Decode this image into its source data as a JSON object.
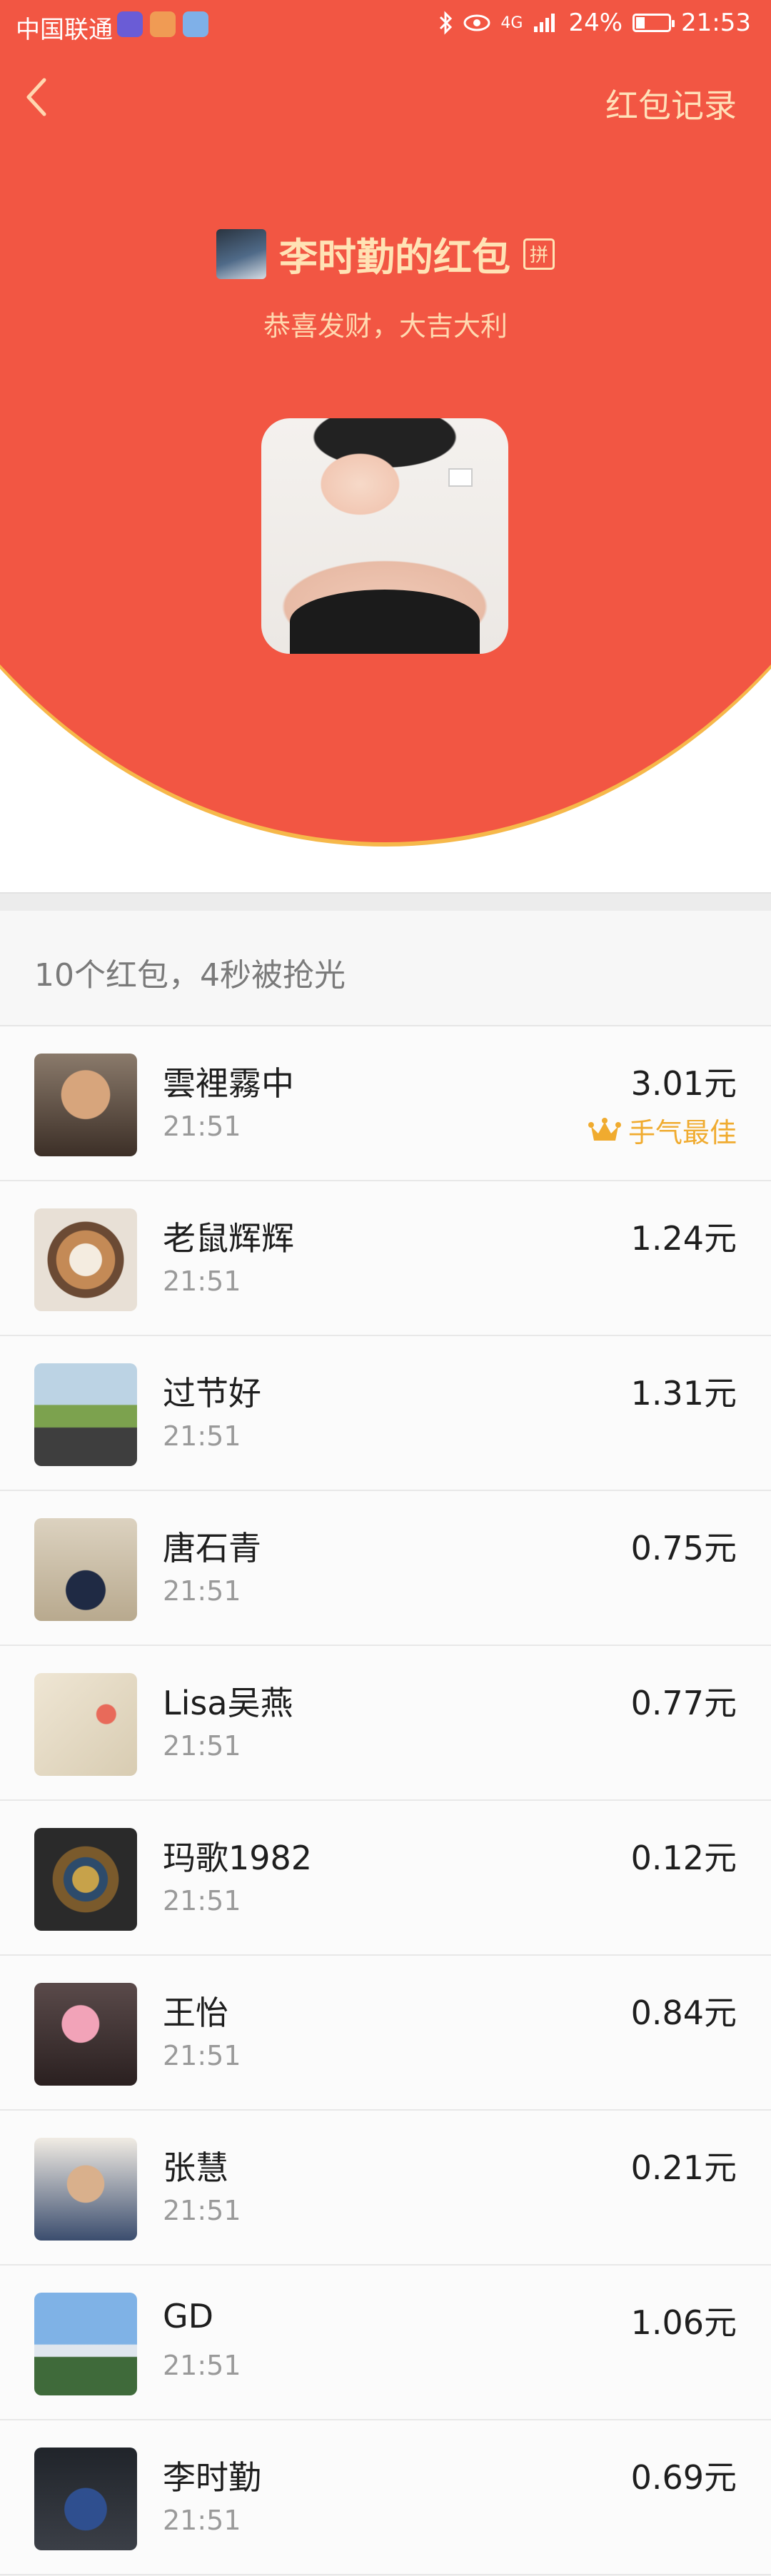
{
  "status_bar": {
    "carrier": "中国联通",
    "network": "4G",
    "battery": "24%",
    "battery_level": 0.24,
    "time": "21:53"
  },
  "nav": {
    "back_icon": "chevron-left-icon",
    "records_label": "红包记录"
  },
  "header": {
    "sender_title": "李时勤的红包",
    "pin_badge": "拼",
    "greeting": "恭喜发财，大吉大利",
    "colors": {
      "dome": "#f25643",
      "title": "#ffe3b5"
    }
  },
  "summary": {
    "text": "10个红包，4秒被抢光"
  },
  "claims": [
    {
      "name": "雲裡霧中",
      "time": "21:51",
      "amount": "3.01元",
      "best": "手气最佳"
    },
    {
      "name": "老鼠辉辉",
      "time": "21:51",
      "amount": "1.24元"
    },
    {
      "name": "过节好",
      "time": "21:51",
      "amount": "1.31元"
    },
    {
      "name": "唐石青",
      "time": "21:51",
      "amount": "0.75元"
    },
    {
      "name": "Lisa吴燕",
      "time": "21:51",
      "amount": "0.77元"
    },
    {
      "name": "玛歌1982",
      "time": "21:51",
      "amount": "0.12元"
    },
    {
      "name": "王怡",
      "time": "21:51",
      "amount": "0.84元"
    },
    {
      "name": "张慧",
      "time": "21:51",
      "amount": "0.21元"
    },
    {
      "name": "GD",
      "time": "21:51",
      "amount": "1.06元"
    },
    {
      "name": "李时勤",
      "time": "21:51",
      "amount": "0.69元"
    }
  ]
}
